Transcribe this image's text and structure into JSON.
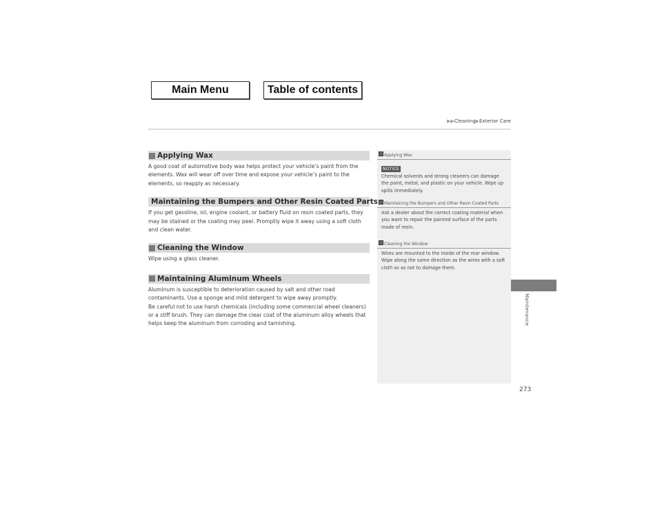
{
  "nav": {
    "main_menu": "Main Menu",
    "table_of_contents": "Table of contents"
  },
  "breadcrumb": {
    "items": [
      "Cleaning",
      "Exterior Care"
    ],
    "separator_icon": "triangle-right-icon"
  },
  "sections": [
    {
      "title": "Applying Wax",
      "paragraphs": [
        "A good coat of automotive body wax helps protect your vehicle’s paint from the elements. Wax will wear off over time and expose your vehicle’s paint to the elements, so reapply as necessary."
      ]
    },
    {
      "title": "Maintaining the Bumpers and Other Resin Coated Parts",
      "paragraphs": [
        "If you get gasoline, oil, engine coolant, or battery fluid on resin coated parts, they may be stained or the coating may peel. Promptly wipe it away using a soft cloth and clean water."
      ]
    },
    {
      "title": "Cleaning the Window",
      "paragraphs": [
        "Wipe using a glass cleaner."
      ]
    },
    {
      "title": "Maintaining Aluminum Wheels",
      "paragraphs": [
        "Aluminum is susceptible to deterioration caused by salt and other road contaminants. Use a sponge and mild detergent to wipe away promptly.",
        "Be careful not to use harsh chemicals (including some commercial wheel cleaners) or a stiff brush. They can damage the clear coat of the aluminum alloy wheels that helps keep the aluminum from corroding and tarnishing."
      ]
    }
  ],
  "side_notes": [
    {
      "title": "Applying Wax",
      "badge": "NOTICE",
      "text": "Chemical solvents and strong cleaners can damage the paint, metal, and plastic on your vehicle. Wipe up spills immediately."
    },
    {
      "title": "Maintaining the Bumpers and Other Resin Coated Parts",
      "text": "Ask a dealer about the correct coating material when you want to repair the painted surface of the parts made of resin."
    },
    {
      "title": "Cleaning the Window",
      "text": "Wires are mounted to the inside of the rear window. Wipe along the same direction as the wires with a soft cloth so as not to damage them."
    }
  ],
  "chapter_tab": "Maintenance",
  "page_number": "273",
  "colors": {
    "section_header_bg": "#dadada",
    "side_panel_bg": "#efefef",
    "thumb_tab": "#7d7d7f",
    "notice_badge": "#595959"
  }
}
